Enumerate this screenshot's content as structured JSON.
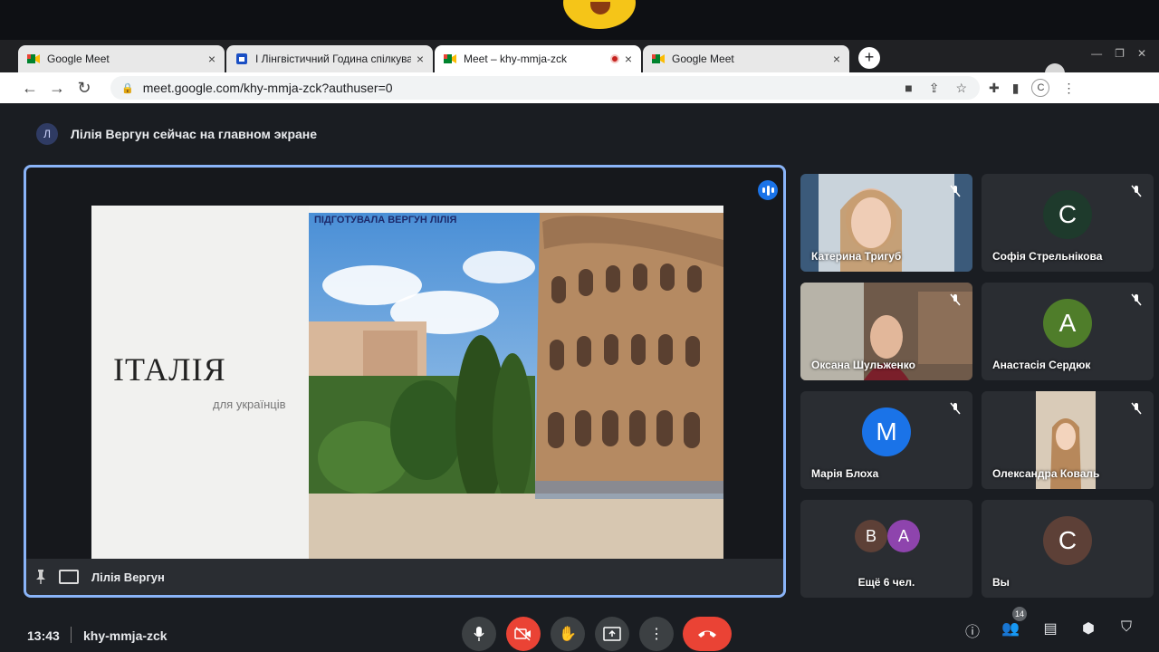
{
  "browser": {
    "tabs": [
      {
        "title": "Google Meet",
        "close": "×"
      },
      {
        "title": "І Лінгвістичний Година спілкування",
        "close": "×"
      },
      {
        "title": "Meet – khy-mmja-zck",
        "close": "×"
      },
      {
        "title": "Google Meet",
        "close": "×"
      }
    ],
    "new_tab": "+",
    "url": "meet.google.com/khy-mmja-zck?authuser=0",
    "profile_initial": "C"
  },
  "meet": {
    "presenter_notice": "Лілія Вергун сейчас на главном экране",
    "presenter_initial": "Л",
    "slide": {
      "title": "ІТАЛІЯ",
      "subtitle": "для українців",
      "credit": "ПІДГОТУВАЛА ВЕРГУН ЛІЛІЯ"
    },
    "stage_name": "Лілія Вергун",
    "participants": [
      {
        "name": "Катерина Тригуб",
        "type": "video"
      },
      {
        "name": "Софія Стрельнікова",
        "initial": "С",
        "color": "#1e3a2c"
      },
      {
        "name": "Оксана Шульженко",
        "type": "video"
      },
      {
        "name": "Анастасія Сердюк",
        "initial": "А",
        "color": "#4f7d2a"
      },
      {
        "name": "Марія Блоха",
        "initial": "М",
        "color": "#1a73e8"
      },
      {
        "name": "Олександра Коваль",
        "type": "video"
      },
      {
        "name": "Ещё 6 чел.",
        "initials": [
          "В",
          "А"
        ],
        "colors": [
          "#5d4037",
          "#8e44ad"
        ]
      },
      {
        "name": "Вы",
        "initial": "С",
        "color": "#5d4037"
      }
    ],
    "time": "13:43",
    "meeting_code": "khy-mmja-zck",
    "people_count": "14"
  }
}
